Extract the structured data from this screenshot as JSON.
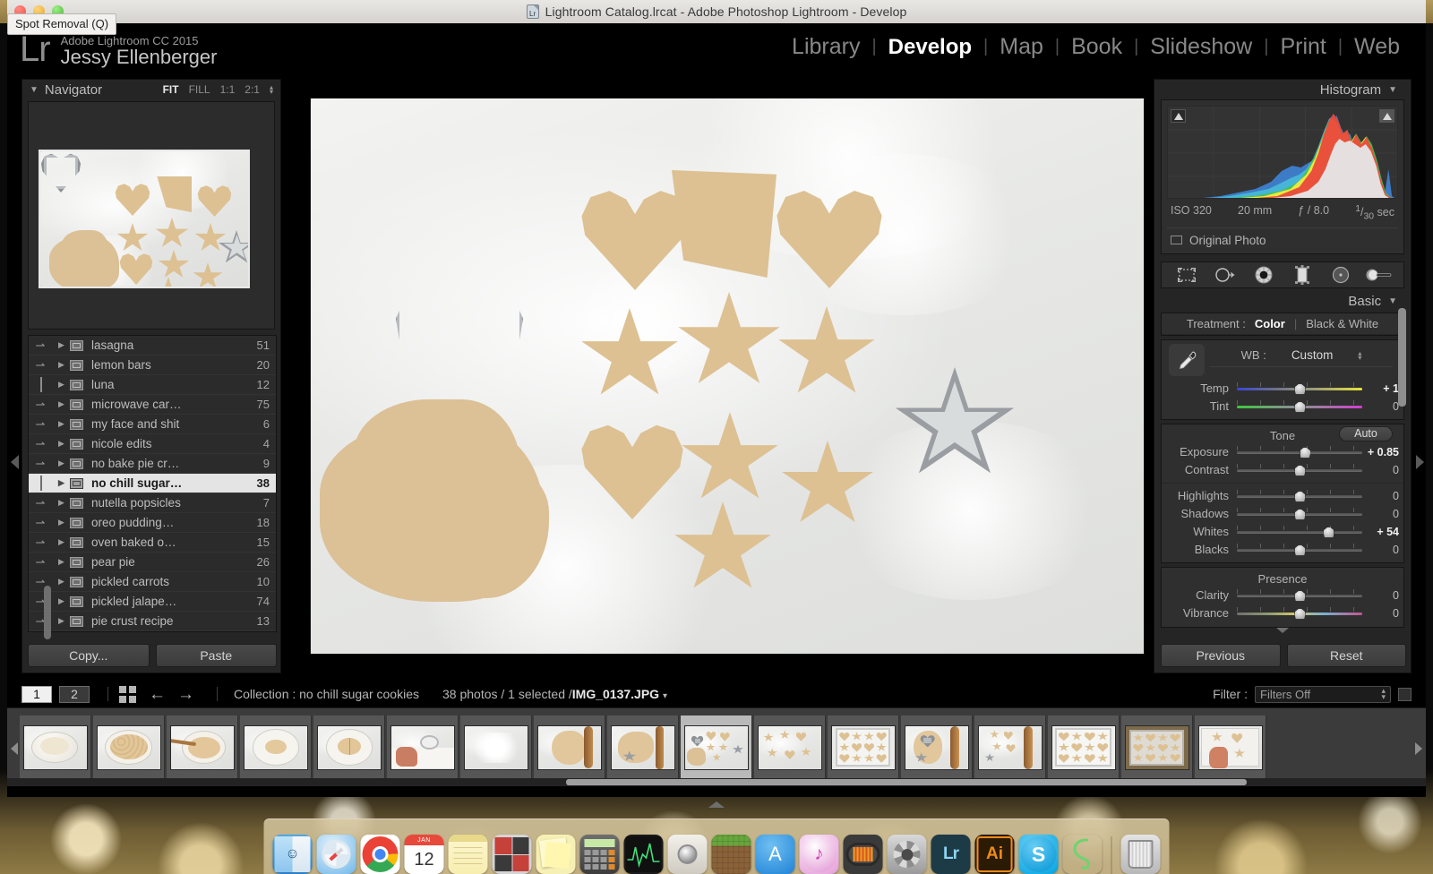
{
  "window": {
    "title": "Lightroom Catalog.lrcat - Adobe Photoshop Lightroom - Develop",
    "tooltip": "Spot Removal (Q)"
  },
  "identity": {
    "logo": "Lr",
    "product": "Adobe Lightroom CC 2015",
    "user": "Jessy Ellenberger"
  },
  "modules": {
    "items": [
      {
        "label": "Library",
        "active": false
      },
      {
        "label": "Develop",
        "active": true
      },
      {
        "label": "Map",
        "active": false
      },
      {
        "label": "Book",
        "active": false
      },
      {
        "label": "Slideshow",
        "active": false
      },
      {
        "label": "Print",
        "active": false
      },
      {
        "label": "Web",
        "active": false
      }
    ],
    "separator": "|"
  },
  "navigator": {
    "title": "Navigator",
    "zoom_levels": [
      {
        "label": "FIT",
        "active": true
      },
      {
        "label": "FILL",
        "active": false
      },
      {
        "label": "1:1",
        "active": false
      },
      {
        "label": "2:1",
        "active": false
      }
    ]
  },
  "collections": {
    "items": [
      {
        "name": "lasagna",
        "count": "51",
        "selected": false,
        "has_arrow": true
      },
      {
        "name": "lemon bars",
        "count": "20",
        "selected": false,
        "has_arrow": true
      },
      {
        "name": "luna",
        "count": "12",
        "selected": false,
        "has_arrow": false
      },
      {
        "name": "microwave car…",
        "count": "75",
        "selected": false,
        "has_arrow": true
      },
      {
        "name": "my face and shit",
        "count": "6",
        "selected": false,
        "has_arrow": true
      },
      {
        "name": "nicole edits",
        "count": "4",
        "selected": false,
        "has_arrow": true
      },
      {
        "name": "no bake pie cr…",
        "count": "9",
        "selected": false,
        "has_arrow": true
      },
      {
        "name": "no chill sugar…",
        "count": "38",
        "selected": true,
        "has_arrow": false
      },
      {
        "name": "nutella popsicles",
        "count": "7",
        "selected": false,
        "has_arrow": true
      },
      {
        "name": "oreo pudding…",
        "count": "18",
        "selected": false,
        "has_arrow": true
      },
      {
        "name": "oven baked o…",
        "count": "15",
        "selected": false,
        "has_arrow": true
      },
      {
        "name": "pear pie",
        "count": "26",
        "selected": false,
        "has_arrow": true
      },
      {
        "name": "pickled carrots",
        "count": "10",
        "selected": false,
        "has_arrow": true
      },
      {
        "name": "pickled jalape…",
        "count": "74",
        "selected": false,
        "has_arrow": true
      },
      {
        "name": "pie crust recipe",
        "count": "13",
        "selected": false,
        "has_arrow": true
      }
    ],
    "copy_label": "Copy...",
    "paste_label": "Paste"
  },
  "histogram": {
    "title": "Histogram",
    "iso": "ISO 320",
    "focal": "20 mm",
    "aperture": "ƒ / 8.0",
    "shutter_num": "1",
    "shutter_den": "30",
    "shutter_unit": "sec",
    "original_photo_label": "Original Photo"
  },
  "tools": {
    "items": [
      {
        "name": "crop-overlay-tool",
        "active": false
      },
      {
        "name": "spot-removal-tool",
        "active": false
      },
      {
        "name": "red-eye-tool",
        "active": false
      },
      {
        "name": "graduated-filter-tool",
        "active": false
      },
      {
        "name": "radial-filter-tool",
        "active": false
      },
      {
        "name": "adjustment-brush-tool",
        "active": false
      }
    ]
  },
  "basic": {
    "title": "Basic",
    "treatment_label": "Treatment :",
    "treatment_options": [
      {
        "label": "Color",
        "active": true
      },
      {
        "label": "Black & White",
        "active": false
      }
    ],
    "wb_label": "WB :",
    "wb_value": "Custom",
    "wb_sliders": [
      {
        "label": "Temp",
        "value": "+ 1",
        "pos": 50,
        "type": "temp",
        "bold": true
      },
      {
        "label": "Tint",
        "value": "0",
        "pos": 50,
        "type": "tint",
        "bold": false
      }
    ],
    "tone_title": "Tone",
    "auto_label": "Auto",
    "tone_sliders": [
      {
        "label": "Exposure",
        "value": "+ 0.85",
        "pos": 54,
        "type": "plain",
        "bold": true
      },
      {
        "label": "Contrast",
        "value": "0",
        "pos": 50,
        "type": "plain",
        "bold": false
      }
    ],
    "tone_sliders2": [
      {
        "label": "Highlights",
        "value": "0",
        "pos": 50,
        "type": "plain",
        "bold": false
      },
      {
        "label": "Shadows",
        "value": "0",
        "pos": 50,
        "type": "plain",
        "bold": false
      },
      {
        "label": "Whites",
        "value": "+ 54",
        "pos": 73,
        "type": "plain",
        "bold": true
      },
      {
        "label": "Blacks",
        "value": "0",
        "pos": 50,
        "type": "plain",
        "bold": false
      }
    ],
    "presence_title": "Presence",
    "presence_sliders": [
      {
        "label": "Clarity",
        "value": "0",
        "pos": 50,
        "type": "plain",
        "bold": false
      },
      {
        "label": "Vibrance",
        "value": "0",
        "pos": 50,
        "type": "vib",
        "bold": false
      }
    ],
    "previous_label": "Previous",
    "reset_label": "Reset"
  },
  "toolbar": {
    "view1": "1",
    "view2": "2",
    "collection_info": "Collection : no chill sugar cookies",
    "photo_count": "38 photos / 1 selected /",
    "photo_name": "IMG_0137.JPG",
    "filter_label": "Filter :",
    "filter_value": "Filters Off"
  },
  "filmstrip": {
    "thumbs": [
      {
        "kind": "bowl-wet",
        "selected": false
      },
      {
        "kind": "bowl-crumbs",
        "selected": false
      },
      {
        "kind": "bowl-spoon",
        "selected": false
      },
      {
        "kind": "bowl-ball",
        "selected": false
      },
      {
        "kind": "bowl-ball-cut",
        "selected": false
      },
      {
        "kind": "hand-scoop",
        "selected": false
      },
      {
        "kind": "flour-board",
        "selected": false
      },
      {
        "kind": "dough-pin",
        "selected": false
      },
      {
        "kind": "cut-shapes",
        "selected": false
      },
      {
        "kind": "cookies-marble",
        "selected": true
      },
      {
        "kind": "cookies-spread",
        "selected": false
      },
      {
        "kind": "tray-rows",
        "selected": false
      },
      {
        "kind": "dough-roller",
        "selected": false
      },
      {
        "kind": "shapes-roller",
        "selected": false
      },
      {
        "kind": "tray-grid",
        "selected": false
      },
      {
        "kind": "tray-baked",
        "selected": false
      },
      {
        "kind": "hand-tray",
        "selected": false
      }
    ]
  },
  "dock": {
    "items": [
      {
        "name": "finder-icon",
        "label": "Finder",
        "running": true
      },
      {
        "name": "safari-icon",
        "label": "Safari",
        "running": true
      },
      {
        "name": "chrome-icon",
        "label": "Google Chrome",
        "running": false
      },
      {
        "name": "calendar-icon",
        "label": "Calendar",
        "day": "12",
        "month": "JAN",
        "running": false
      },
      {
        "name": "notes-icon",
        "label": "Notes",
        "running": false
      },
      {
        "name": "photo-booth-icon",
        "label": "Photo Booth",
        "running": false
      },
      {
        "name": "stickies-icon",
        "label": "Stickies",
        "running": true
      },
      {
        "name": "calculator-icon",
        "label": "Calculator",
        "running": false
      },
      {
        "name": "activity-monitor-icon",
        "label": "Activity Monitor",
        "running": false
      },
      {
        "name": "image-capture-icon",
        "label": "Image Capture",
        "running": false
      },
      {
        "name": "minecraft-icon",
        "label": "Minecraft",
        "running": false
      },
      {
        "name": "app-store-icon",
        "label": "App Store",
        "running": false
      },
      {
        "name": "itunes-icon",
        "label": "iTunes",
        "running": false
      },
      {
        "name": "audacity-icon",
        "label": "Audacity",
        "running": false
      },
      {
        "name": "system-preferences-icon",
        "label": "System Preferences",
        "running": false
      },
      {
        "name": "lightroom-icon",
        "label": "Lr",
        "running": true
      },
      {
        "name": "illustrator-icon",
        "label": "Ai",
        "running": false
      },
      {
        "name": "skype-icon",
        "label": "S",
        "running": false
      },
      {
        "name": "sketch-icon",
        "label": "Sketch",
        "running": false
      }
    ],
    "trash": {
      "name": "trash-icon",
      "label": "Trash"
    }
  }
}
